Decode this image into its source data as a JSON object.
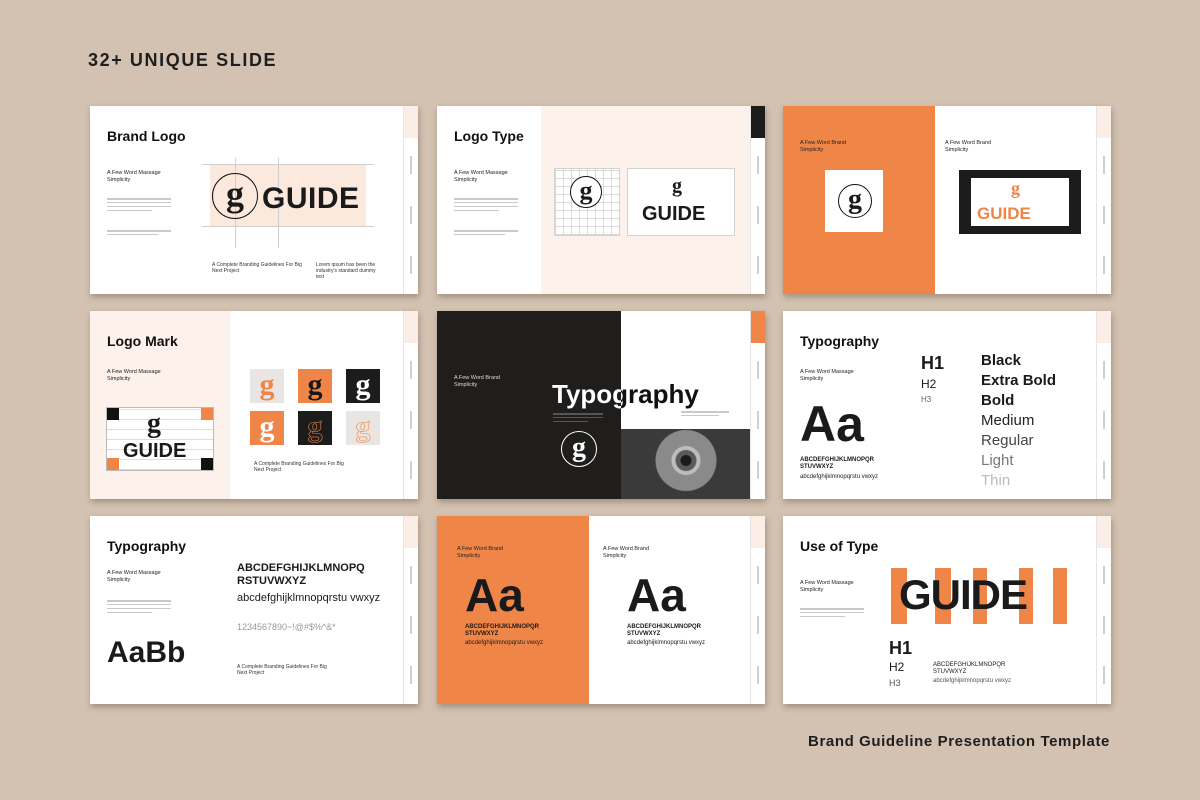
{
  "header": {
    "title": "32+ UNIQUE SLIDE"
  },
  "footer": {
    "caption": "Brand Guideline Presentation Template"
  },
  "common": {
    "subtitle": "A Few Word Massage Simplicity",
    "subtitle_alt": "A Few Word Brand Simplicity",
    "guide_word": "GUIDE",
    "g_letter": "g",
    "tagline": "A Complete Branding Guidelines For Big Next Project",
    "dummy": "Lorem ipsum has been the industry's standard dummy text"
  },
  "slides": {
    "brand_logo": {
      "title": "Brand Logo"
    },
    "logo_type": {
      "title": "Logo Type"
    },
    "logo_mark": {
      "title": "Logo Mark"
    },
    "typography_cover": {
      "title": "Typography"
    },
    "typography_weights": {
      "title": "Typography",
      "aa": "Aa",
      "upper": "ABCDEFGHIJKLMNOPQR STUVWXYZ",
      "lower": "abcdefghijklmnopqrstu vwxyz",
      "h1": "H1",
      "h2": "H2",
      "h3": "H3",
      "weights": [
        "Black",
        "Extra Bold",
        "Bold",
        "Medium",
        "Regular",
        "Light",
        "Thin"
      ]
    },
    "typography_alphabet": {
      "title": "Typography",
      "upper": "ABCDEFGHIJKLMNOPQ RSTUVWXYZ",
      "lower": "abcdefghijklmnopqrstu vwxyz",
      "numbers": "1234567890~!@#$%^&*",
      "aabb": "AaBb"
    },
    "aa_pair": {
      "aa": "Aa",
      "upper": "ABCDEFGHIJKLMNOPQR STUVWXYZ",
      "lower": "abcdefghijklmnopqrstu vwxyz"
    },
    "use_of_type": {
      "title": "Use of Type",
      "h1": "H1",
      "h2": "H2",
      "h3": "H3",
      "upper": "ABCDEFGHIJKLMNOPQR STUVWXYZ",
      "lower": "abcdefghijklmnopqrstu vwxyz"
    }
  },
  "colors": {
    "background": "#d3c2b1",
    "accent": "#f08548",
    "dark": "#1f1e1c",
    "cream": "#fcf2eb"
  }
}
